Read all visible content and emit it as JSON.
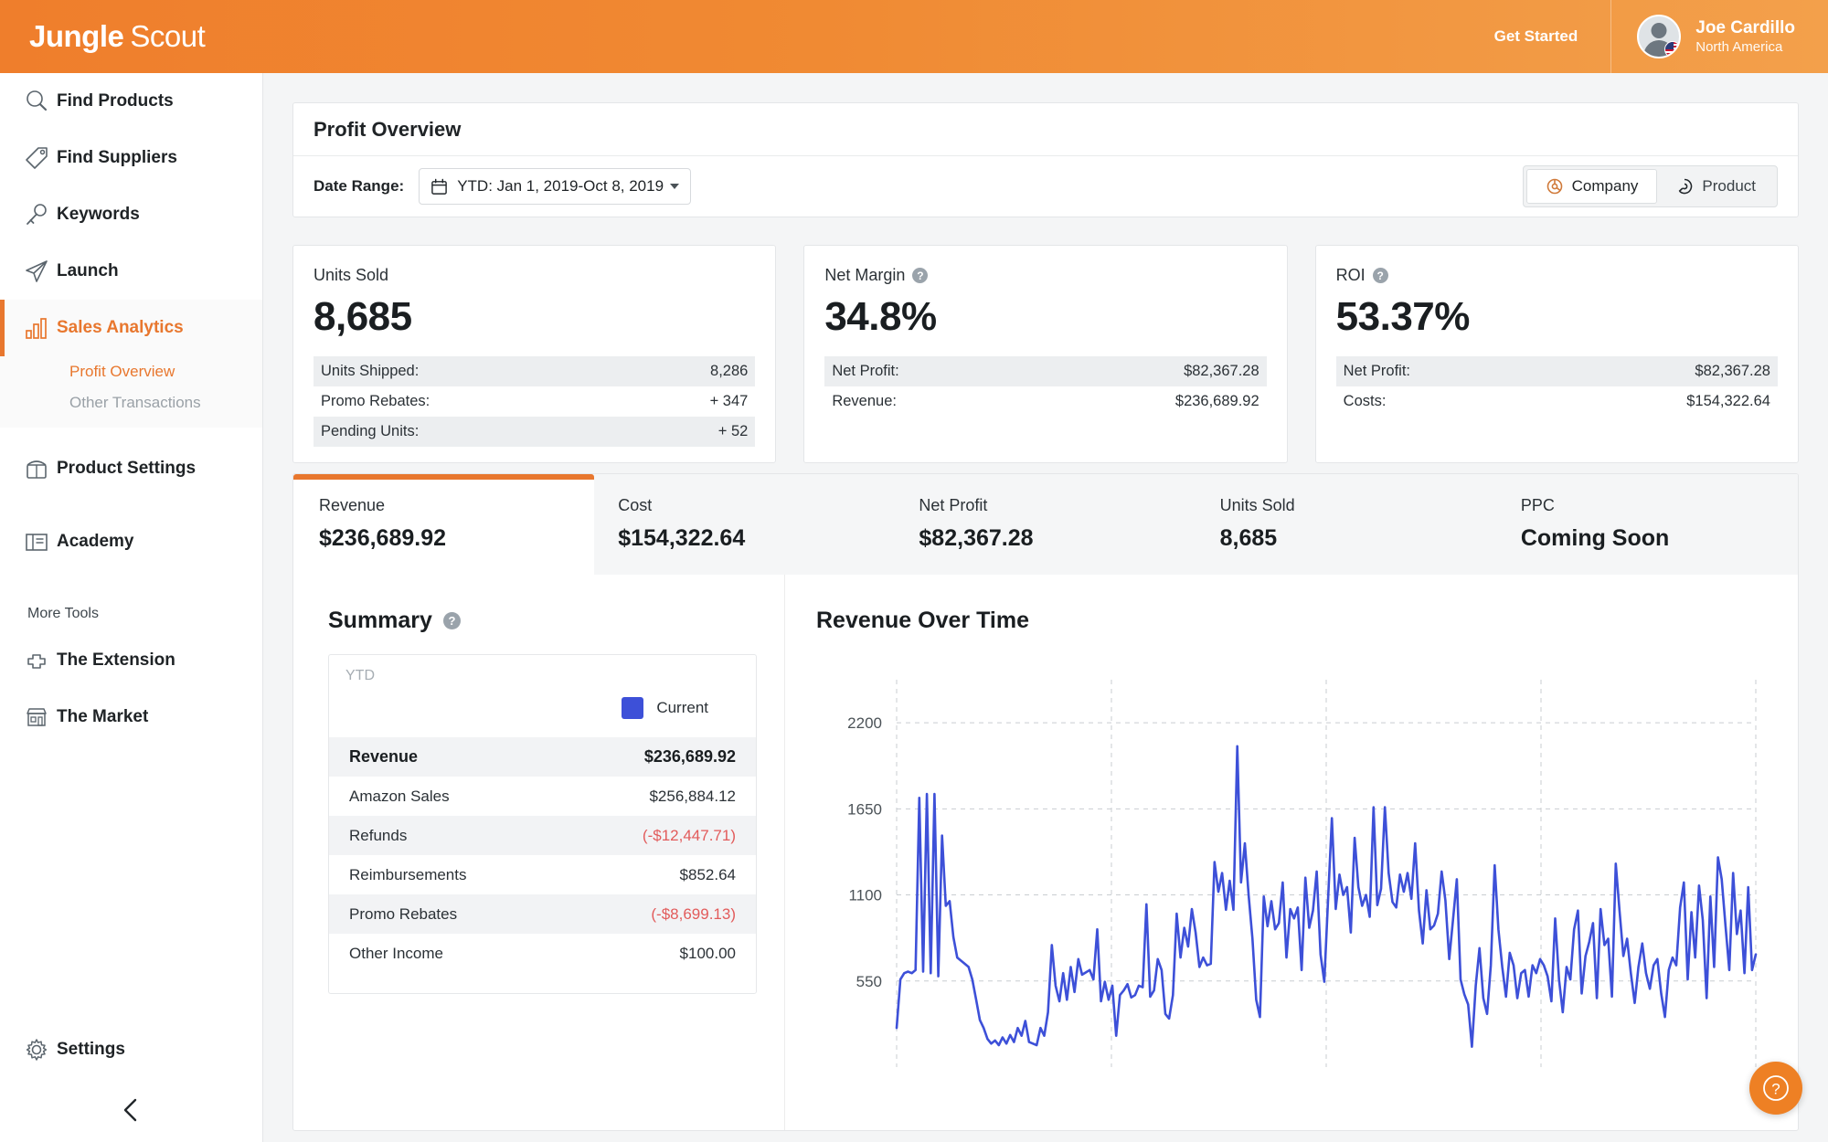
{
  "header": {
    "logo_bold": "Jungle",
    "logo_light": "Scout",
    "get_started": "Get Started",
    "user_name": "Joe Cardillo",
    "user_region": "North America"
  },
  "sidebar": {
    "items": [
      {
        "label": "Find Products",
        "icon": "magnifier-icon"
      },
      {
        "label": "Find Suppliers",
        "icon": "tag-icon"
      },
      {
        "label": "Keywords",
        "icon": "key-icon"
      },
      {
        "label": "Launch",
        "icon": "paper-plane-icon"
      },
      {
        "label": "Sales Analytics",
        "icon": "bar-chart-icon"
      }
    ],
    "subitems": [
      {
        "label": "Profit Overview",
        "selected": true
      },
      {
        "label": "Other Transactions",
        "selected": false
      }
    ],
    "items2": [
      {
        "label": "Product Settings",
        "icon": "box-icon"
      },
      {
        "label": "Academy",
        "icon": "book-icon"
      }
    ],
    "more_tools_label": "More Tools",
    "items3": [
      {
        "label": "The Extension",
        "icon": "puzzle-icon"
      },
      {
        "label": "The Market",
        "icon": "storefront-icon"
      }
    ],
    "settings": {
      "label": "Settings",
      "icon": "gear-icon"
    }
  },
  "overview": {
    "title": "Profit Overview",
    "date_range_label": "Date Range:",
    "date_range_value": "YTD: Jan 1, 2019-Oct 8, 2019",
    "toggle": {
      "company": "Company",
      "product": "Product",
      "selected": "Company"
    }
  },
  "kpis": [
    {
      "label": "Units Sold",
      "has_help": false,
      "value": "8,685",
      "rows": [
        {
          "label": "Units Shipped:",
          "value": "8,286",
          "alt": true
        },
        {
          "label": "Promo Rebates:",
          "value": "+ 347",
          "alt": false
        },
        {
          "label": "Pending Units:",
          "value": "+ 52",
          "alt": true
        }
      ]
    },
    {
      "label": "Net Margin",
      "has_help": true,
      "value": "34.8%",
      "rows": [
        {
          "label": "Net Profit:",
          "value": "$82,367.28",
          "alt": true
        },
        {
          "label": "Revenue:",
          "value": "$236,689.92",
          "alt": false
        }
      ]
    },
    {
      "label": "ROI",
      "has_help": true,
      "value": "53.37%",
      "rows": [
        {
          "label": "Net Profit:",
          "value": "$82,367.28",
          "alt": true
        },
        {
          "label": "Costs:",
          "value": "$154,322.64",
          "alt": false
        }
      ]
    }
  ],
  "tabs": [
    {
      "label": "Revenue",
      "value": "$236,689.92",
      "active": true
    },
    {
      "label": "Cost",
      "value": "$154,322.64",
      "active": false
    },
    {
      "label": "Net Profit",
      "value": "$82,367.28",
      "active": false
    },
    {
      "label": "Units Sold",
      "value": "8,685",
      "active": false
    },
    {
      "label": "PPC",
      "value": "Coming Soon",
      "active": false
    }
  ],
  "summary": {
    "title": "Summary",
    "period": "YTD",
    "legend_label": "Current",
    "legend_color": "#3d50d8",
    "rows": [
      {
        "label": "Revenue",
        "value": "$236,689.92",
        "alt": true,
        "bold": true,
        "negative": false
      },
      {
        "label": "Amazon Sales",
        "value": "$256,884.12",
        "alt": false,
        "bold": false,
        "negative": false
      },
      {
        "label": "Refunds",
        "value": "(-$12,447.71)",
        "alt": true,
        "bold": false,
        "negative": true
      },
      {
        "label": "Reimbursements",
        "value": "$852.64",
        "alt": false,
        "bold": false,
        "negative": false
      },
      {
        "label": "Promo Rebates",
        "value": "(-$8,699.13)",
        "alt": true,
        "bold": false,
        "negative": true
      },
      {
        "label": "Other Income",
        "value": "$100.00",
        "alt": false,
        "bold": false,
        "negative": false
      }
    ]
  },
  "chart_data": {
    "type": "line",
    "title": "Revenue Over Time",
    "xlabel": "",
    "ylabel": "",
    "ylim": [
      0,
      2475
    ],
    "yticks": [
      550,
      1100,
      1650,
      2200
    ],
    "grid": true,
    "legend": [
      "Current"
    ],
    "legend_position": "none",
    "line_color": "#3d50d8",
    "series": [
      {
        "name": "Current",
        "values": [
          250,
          560,
          600,
          610,
          600,
          620,
          1720,
          610,
          1745,
          600,
          1745,
          580,
          1480,
          1030,
          1060,
          830,
          700,
          680,
          660,
          640,
          560,
          430,
          300,
          250,
          180,
          150,
          170,
          140,
          190,
          150,
          205,
          160,
          250,
          200,
          295,
          160,
          150,
          140,
          250,
          200,
          350,
          780,
          520,
          420,
          600,
          430,
          640,
          480,
          690,
          590,
          605,
          620,
          560,
          880,
          420,
          545,
          430,
          520,
          200,
          460,
          490,
          530,
          445,
          460,
          520,
          510,
          1040,
          450,
          490,
          690,
          620,
          340,
          310,
          460,
          980,
          700,
          890,
          770,
          1010,
          860,
          640,
          700,
          650,
          660,
          1310,
          1120,
          1240,
          1005,
          1190,
          1005,
          2050,
          1180,
          1430,
          1100,
          820,
          430,
          320,
          1090,
          900,
          1060,
          880,
          920,
          1180,
          700,
          1010,
          950,
          1020,
          620,
          1210,
          890,
          1000,
          1250,
          720,
          545,
          1080,
          1590,
          1010,
          1230,
          1100,
          1150,
          860,
          1465,
          1150,
          1030,
          1100,
          960,
          1660,
          1035,
          1140,
          1660,
          1240,
          1055,
          1020,
          1230,
          1120,
          1240,
          1075,
          1430,
          1000,
          790,
          1130,
          880,
          905,
          980,
          1250,
          1065,
          690,
          940,
          1200,
          560,
          465,
          400,
          130,
          520,
          760,
          440,
          340,
          650,
          1290,
          880,
          640,
          450,
          730,
          650,
          440,
          600,
          620,
          450,
          650,
          600,
          690,
          650,
          580,
          420,
          950,
          560,
          350,
          640,
          560,
          880,
          1000,
          470,
          710,
          800,
          920,
          440,
          1010,
          780,
          820,
          450,
          1300,
          1000,
          710,
          820,
          600,
          410,
          640,
          790,
          600,
          500,
          650,
          690,
          470,
          320,
          620,
          700,
          650,
          1020,
          1180,
          560,
          990,
          700,
          1160,
          940,
          440,
          1090,
          640,
          1340,
          1200,
          900,
          620,
          1240,
          850,
          1000,
          600,
          1150,
          620,
          720
        ]
      }
    ]
  },
  "fab": {
    "icon": "help-icon"
  }
}
